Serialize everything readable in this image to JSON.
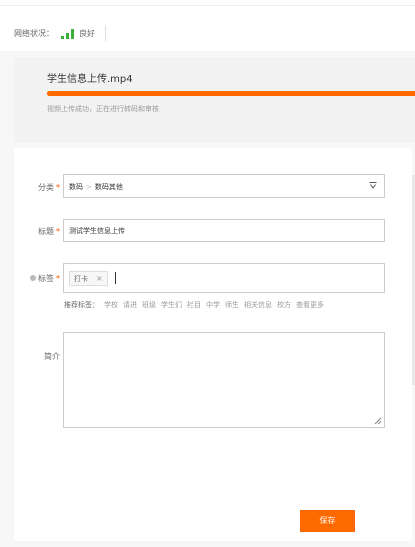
{
  "network": {
    "label": "网络状况：",
    "status": "良好",
    "signal_color": "#3cb035"
  },
  "upload": {
    "file_name": "学生信息上传.mp4",
    "progress_percent": 100,
    "status_text": "视频上传成功，正在进行转码和审核",
    "accent_color": "#ff6a00"
  },
  "form": {
    "category": {
      "label": "分类",
      "level1": "数码",
      "separator": ">",
      "level2": "数码其他",
      "arrow_icon": "chevron-down-icon"
    },
    "title": {
      "label": "标题",
      "value": "测试学生信息上传"
    },
    "tags": {
      "label": "标签",
      "items": [
        {
          "text": "打卡",
          "remove": "×"
        }
      ],
      "recommend_title": "推荐标签：",
      "recommended": [
        "学校",
        "请进",
        "班级",
        "学生们",
        "栏目",
        "中学",
        "师生",
        "相关信息",
        "校方",
        "查看更多"
      ]
    },
    "intro": {
      "label": "简介",
      "value": ""
    },
    "required_mark": "*",
    "save_label": "保存"
  }
}
